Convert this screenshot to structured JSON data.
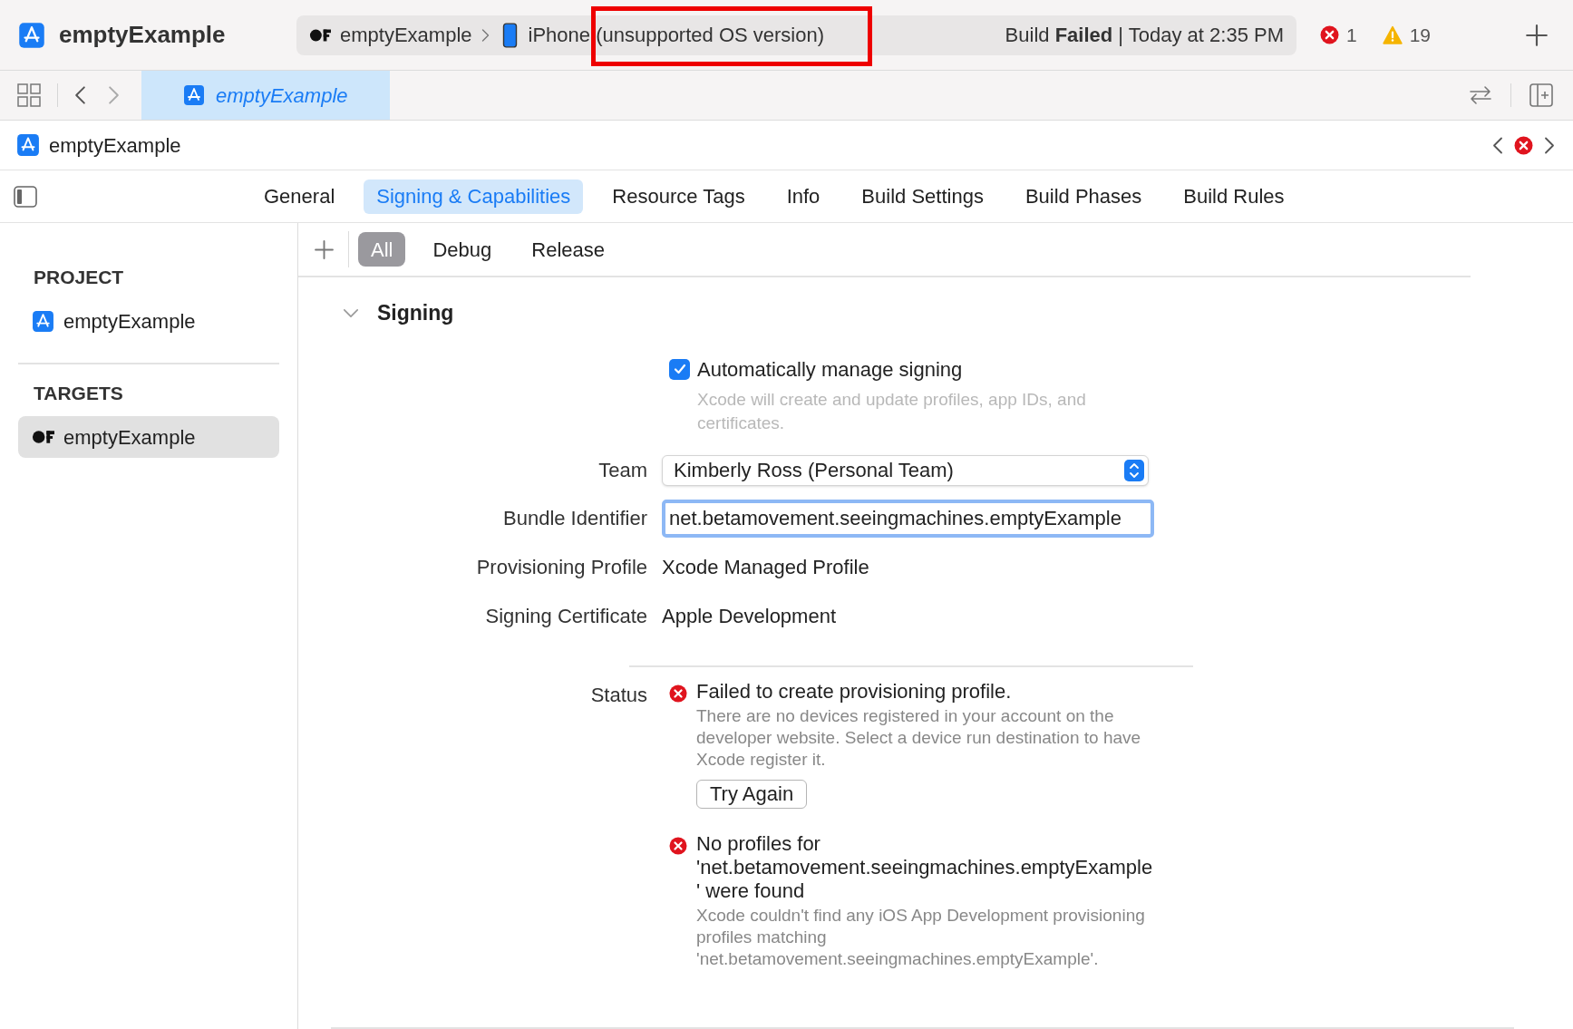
{
  "toolbar": {
    "title": "emptyExample",
    "scheme": "emptyExample",
    "device": "iPhone (unsupported OS version)",
    "build_status": "Build **Failed** | Today at 2:35 PM",
    "errors": "1",
    "warnings": "19"
  },
  "editor_tabs": [
    {
      "label": "emptyExample",
      "selected": true
    }
  ],
  "breadcrumb": "emptyExample",
  "tabs": [
    {
      "label": "General",
      "selected": false
    },
    {
      "label": "Signing & Capabilities",
      "selected": true
    },
    {
      "label": "Resource Tags",
      "selected": false
    },
    {
      "label": "Info",
      "selected": false
    },
    {
      "label": "Build Settings",
      "selected": false
    },
    {
      "label": "Build Phases",
      "selected": false
    },
    {
      "label": "Build Rules",
      "selected": false
    }
  ],
  "sidebar": [
    {
      "heading": "PROJECT",
      "items": [
        {
          "label": "emptyExample",
          "kind": "project",
          "selected": false
        }
      ]
    },
    {
      "heading": "TARGETS",
      "items": [
        {
          "label": "emptyExample",
          "kind": "target",
          "selected": true
        }
      ]
    }
  ],
  "filters": [
    {
      "label": "All",
      "selected": true
    },
    {
      "label": "Debug",
      "selected": false
    },
    {
      "label": "Release",
      "selected": false
    }
  ],
  "signing": {
    "title": "Signing",
    "expanded": true,
    "auto_manage": {
      "label": "Automatically manage signing",
      "checked": true,
      "hint": "Xcode will create and update profiles, app IDs, and certificates."
    },
    "rows": [
      {
        "label": "Team",
        "kind": "popup",
        "value": "Kimberly Ross (Personal Team)"
      },
      {
        "label": "Bundle Identifier",
        "kind": "field",
        "value": "net.betamovement.seeingmachines.emptyExample"
      },
      {
        "label": "Provisioning Profile",
        "kind": "text",
        "value": "Xcode Managed Profile"
      },
      {
        "label": "Signing Certificate",
        "kind": "text",
        "value": "Apple Development"
      }
    ],
    "status": {
      "label": "Status",
      "messages": [
        {
          "title": "Failed to create provisioning profile.",
          "detail": "There are no devices registered in your account on the developer website. Select a device run destination to have Xcode register it.",
          "button": "Try Again"
        },
        {
          "title": "No profiles for 'net.betamovement.seeingmachines.emptyExample' were found",
          "detail": "Xcode couldn't find any iOS App Development provisioning profiles matching 'net.betamovement.seeingmachines.emptyExample'."
        }
      ]
    }
  }
}
